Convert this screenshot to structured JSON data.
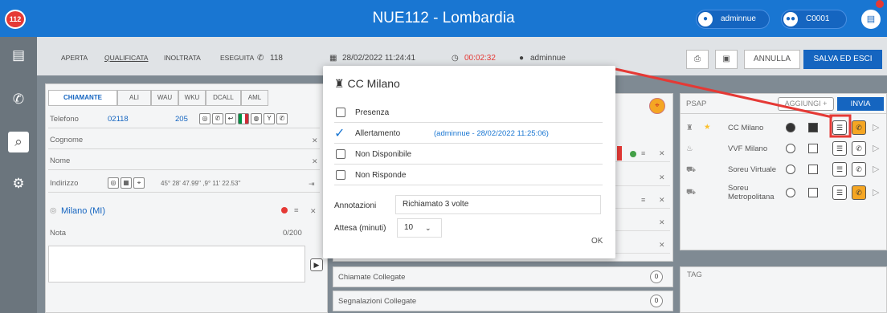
{
  "header": {
    "logo": "112",
    "title": "NUE112 - Lombardia",
    "user": "adminnue",
    "station": "C0001",
    "user_icon": "user-icon",
    "station_icon": "users-icon",
    "chat_icon": "chat-icon"
  },
  "sidebar": {
    "items": [
      {
        "icon": "document-icon",
        "glyph": "▤"
      },
      {
        "icon": "phone-icon",
        "glyph": "✆"
      },
      {
        "icon": "map-search-icon",
        "glyph": "⌕"
      },
      {
        "icon": "gear-icon",
        "glyph": "⚙"
      }
    ]
  },
  "status": {
    "items": [
      "APERTA",
      "QUALIFICATA",
      "INOLTRATA",
      "ESEGUITA"
    ],
    "active": "QUALIFICATA"
  },
  "call": {
    "number": "118",
    "date": "28/02/2022 11:24:41",
    "timer": "00:02:32",
    "operator": "adminnue"
  },
  "actions": {
    "annulla": "ANNULLA",
    "salva": "SALVA ED ESCI"
  },
  "caller": {
    "tabs": [
      "CHIAMANTE",
      "ALI",
      "WAU",
      "WKU",
      "DCALL",
      "AML"
    ],
    "fields": {
      "telefono_label": "Telefono",
      "telefono_value": "02118",
      "telefono_ext": "205",
      "cognome_label": "Cognome",
      "nome_label": "Nome",
      "indirizzo_label": "Indirizzo",
      "coords": "45° 28' 47.99'' ,9° 11' 22.53''",
      "location": "Milano (MI)",
      "nota_label": "Nota",
      "nota_count": "0/200"
    }
  },
  "linked": {
    "chiamate": "Chiamate Collegate",
    "chiamate_count": "0",
    "segnalazioni": "Segnalazioni Collegate",
    "segnalazioni_count": "0"
  },
  "psap": {
    "title": "PSAP",
    "add": "AGGIUNGI +",
    "send": "INVIA",
    "tag": "TAG",
    "rows": [
      {
        "name": "CC Milano",
        "star": true
      },
      {
        "name": "VVF Milano",
        "star": false
      },
      {
        "name": "Soreu Virtuale",
        "star": false
      },
      {
        "name": "Soreu Metropolitana",
        "star": false
      }
    ]
  },
  "modal": {
    "title": "CC Milano",
    "items": [
      {
        "label": "Presenza",
        "checked": false,
        "note": ""
      },
      {
        "label": "Allertamento",
        "checked": true,
        "note": "(adminnue - 28/02/2022 11:25:06)"
      },
      {
        "label": "Non Disponibile",
        "checked": false,
        "note": ""
      },
      {
        "label": "Non Risponde",
        "checked": false,
        "note": ""
      }
    ],
    "annotazioni_label": "Annotazioni",
    "annotazioni_value": "Richiamato 3 volte",
    "attesa_label": "Attesa (minuti)",
    "attesa_value": "10",
    "ok": "OK"
  },
  "colors": {
    "primary": "#1976d2",
    "accent_red": "#e53935",
    "orange": "#f5a623"
  }
}
